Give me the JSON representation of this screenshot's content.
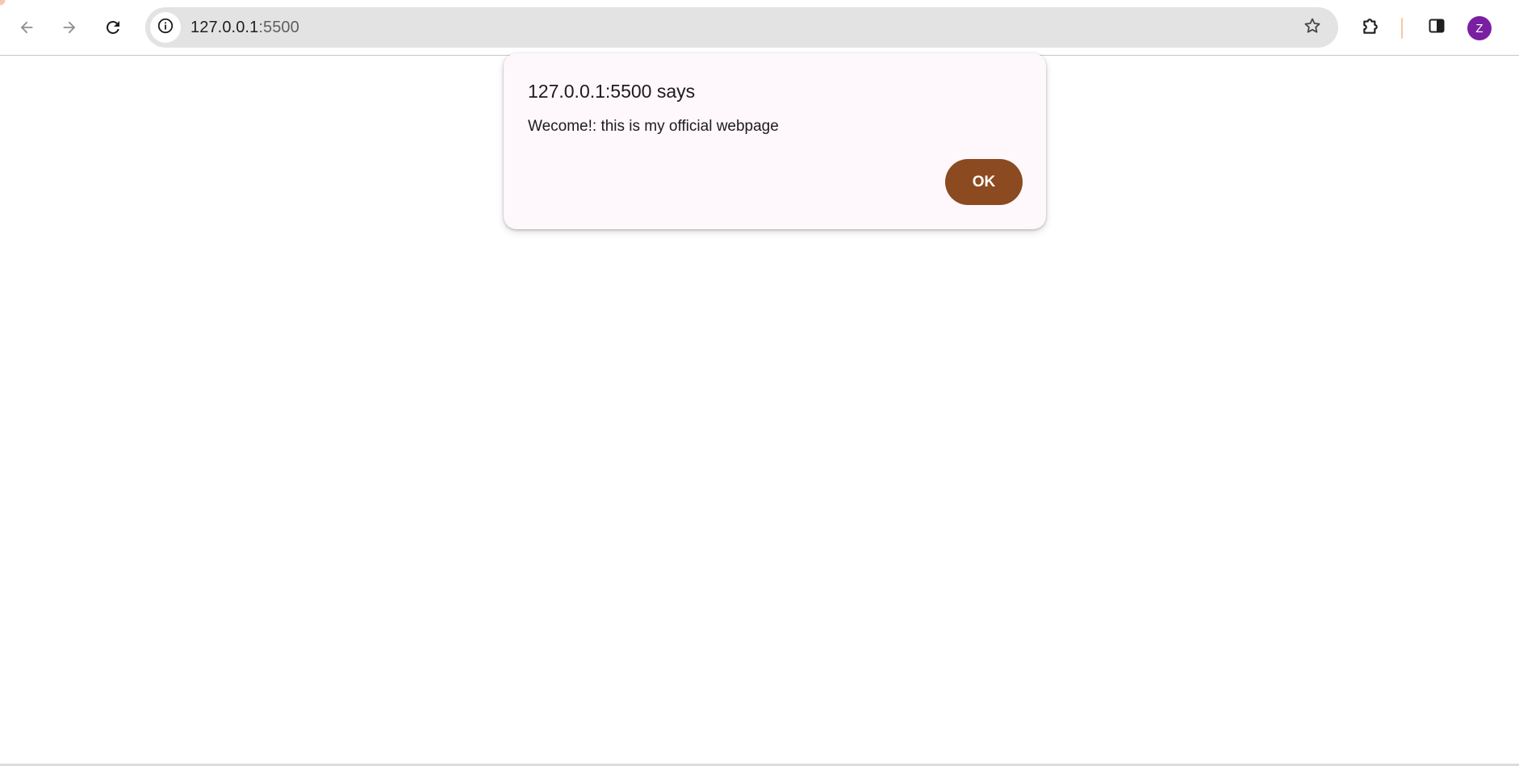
{
  "browser": {
    "url_host": "127.0.0.1",
    "url_port": ":5500",
    "avatar_initial": "Z",
    "colors": {
      "avatar": "#7b1fa2",
      "omnibox": "#e3e3e3"
    },
    "icons": {
      "back": "arrow-left-icon",
      "forward": "arrow-right-icon",
      "reload": "reload-icon",
      "site_info": "info-icon",
      "bookmark": "star-icon",
      "extensions": "puzzle-icon",
      "side_panel": "side-panel-icon"
    }
  },
  "dialog": {
    "title": "127.0.0.1:5500 says",
    "message": "Wecome!: this is my official webpage",
    "ok_label": "OK",
    "colors": {
      "background": "#fef7fc",
      "ok_button": "#8b4a1f"
    }
  }
}
